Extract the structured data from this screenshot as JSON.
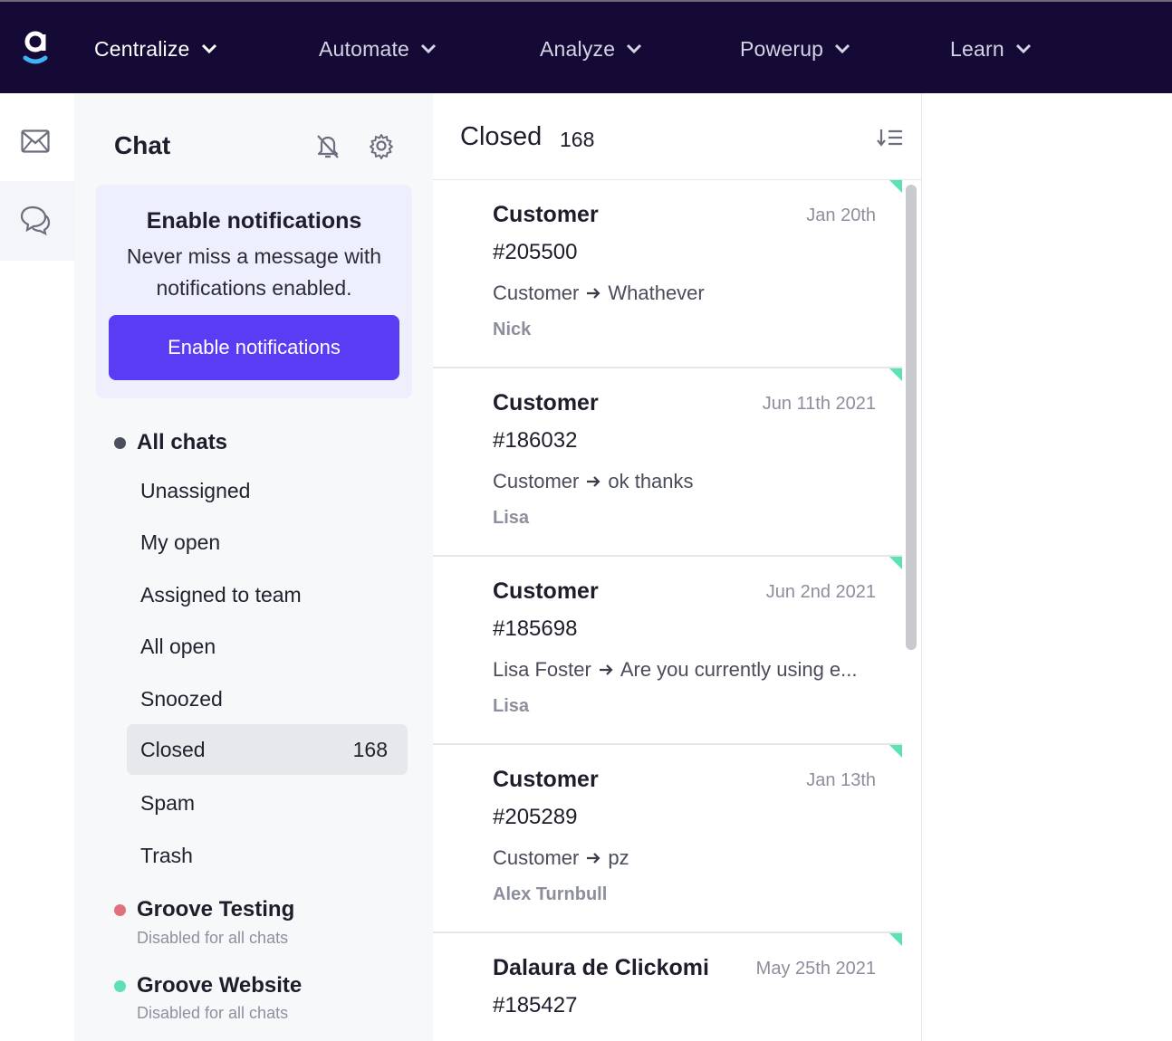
{
  "topnav": {
    "items": [
      {
        "label": "Centralize"
      },
      {
        "label": "Automate"
      },
      {
        "label": "Analyze"
      },
      {
        "label": "Powerup"
      },
      {
        "label": "Learn"
      }
    ]
  },
  "rail": {
    "icons": [
      "mail-icon",
      "chat-bubbles-icon"
    ]
  },
  "sidebar": {
    "title": "Chat",
    "notification_card": {
      "title": "Enable notifications",
      "body": "Never miss a message with notifications enabled.",
      "button_label": "Enable notifications"
    },
    "all_chats": {
      "label": "All chats",
      "dot_color": "#4b4e5c"
    },
    "folders": [
      {
        "label": "Unassigned",
        "count": ""
      },
      {
        "label": "My open",
        "count": ""
      },
      {
        "label": "Assigned to team",
        "count": ""
      },
      {
        "label": "All open",
        "count": ""
      },
      {
        "label": "Snoozed",
        "count": ""
      },
      {
        "label": "Closed",
        "count": "168",
        "active": true
      },
      {
        "label": "Spam",
        "count": ""
      },
      {
        "label": "Trash",
        "count": ""
      }
    ],
    "groups": [
      {
        "label": "Groove Testing",
        "sub": "Disabled for all chats",
        "dot_color": "#e0707e"
      },
      {
        "label": "Groove Website",
        "sub": "Disabled for all chats",
        "dot_color": "#5fe0b4"
      }
    ]
  },
  "list": {
    "title": "Closed",
    "count": "168",
    "conversations": [
      {
        "name": "Customer",
        "date": "Jan 20th",
        "number": "#205500",
        "from": "Customer",
        "message": "Whathever",
        "agent": "Nick"
      },
      {
        "name": "Customer",
        "date": "Jun 11th 2021",
        "number": "#186032",
        "from": "Customer",
        "message": "ok thanks",
        "agent": "Lisa"
      },
      {
        "name": "Customer",
        "date": "Jun 2nd 2021",
        "number": "#185698",
        "from": "Lisa Foster",
        "message": "Are you currently using e...",
        "agent": "Lisa"
      },
      {
        "name": "Customer",
        "date": "Jan 13th",
        "number": "#205289",
        "from": "Customer",
        "message": "pz",
        "agent": "Alex Turnbull"
      },
      {
        "name": "Dalaura de Clickomi",
        "date": "May 25th 2021",
        "number": "#185427",
        "from": "",
        "message": "",
        "agent": ""
      }
    ]
  },
  "colors": {
    "topbar": "#150a35",
    "accent": "#5b3cf5",
    "unread_corner": "#5fe0b4"
  }
}
